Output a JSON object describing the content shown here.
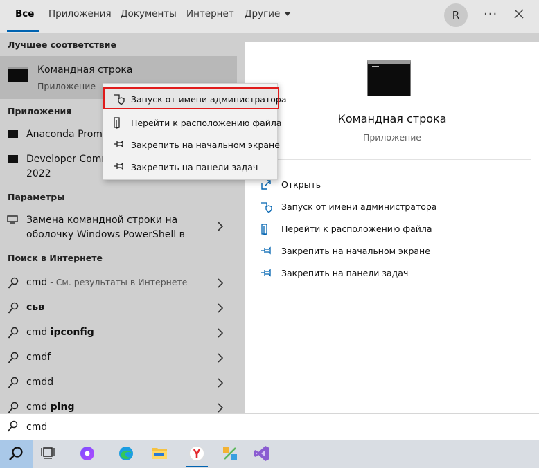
{
  "tabs": [
    {
      "label": "Все",
      "active": true
    },
    {
      "label": "Приложения"
    },
    {
      "label": "Документы"
    },
    {
      "label": "Интернет"
    },
    {
      "label": "Другие"
    }
  ],
  "user_initial": "R",
  "left": {
    "best_match_title": "Лучшее соответствие",
    "best_match": {
      "name": "Командная строка",
      "type": "Приложение"
    },
    "apps_title": "Приложения",
    "apps": [
      {
        "line1": "Anaconda Promp"
      },
      {
        "line1": "Developer Comm",
        "line2": "2022"
      }
    ],
    "settings_title": "Параметры",
    "settings": [
      {
        "line1": "Замена командной строки на",
        "line2": "оболочку Windows PowerShell в"
      }
    ],
    "web_title": "Поиск в Интернете",
    "web": [
      {
        "query": "cmd",
        "hint": " - См. результаты в Интернете"
      },
      {
        "prefix": "",
        "bold": "сьв"
      },
      {
        "prefix": "cmd ",
        "bold": "ipconfig"
      },
      {
        "prefix": "cmdf",
        "bold": ""
      },
      {
        "prefix": "cmdd",
        "bold": ""
      },
      {
        "prefix": "cmd ",
        "bold": "ping"
      }
    ]
  },
  "context_menu": [
    {
      "label": "Запуск от имени администратора",
      "icon": "shield-icon",
      "highlighted": true
    },
    {
      "label": "Перейти к расположению файла",
      "icon": "folder-file-icon"
    },
    {
      "label": "Закрепить на начальном экране",
      "icon": "pin-icon"
    },
    {
      "label": "Закрепить на панели задач",
      "icon": "pin-icon"
    }
  ],
  "right": {
    "title": "Командная строка",
    "subtitle": "Приложение",
    "actions": [
      {
        "label": "Открыть",
        "icon": "open-icon"
      },
      {
        "label": "Запуск от имени администратора",
        "icon": "shield-icon"
      },
      {
        "label": "Перейти к расположению файла",
        "icon": "folder-file-icon"
      },
      {
        "label": "Закрепить на начальном экране",
        "icon": "pin-icon"
      },
      {
        "label": "Закрепить на панели задач",
        "icon": "pin-icon"
      }
    ]
  },
  "search": {
    "value": "cmd"
  },
  "colors": {
    "accent": "#0063b1",
    "highlight_border": "#e01b1b"
  }
}
